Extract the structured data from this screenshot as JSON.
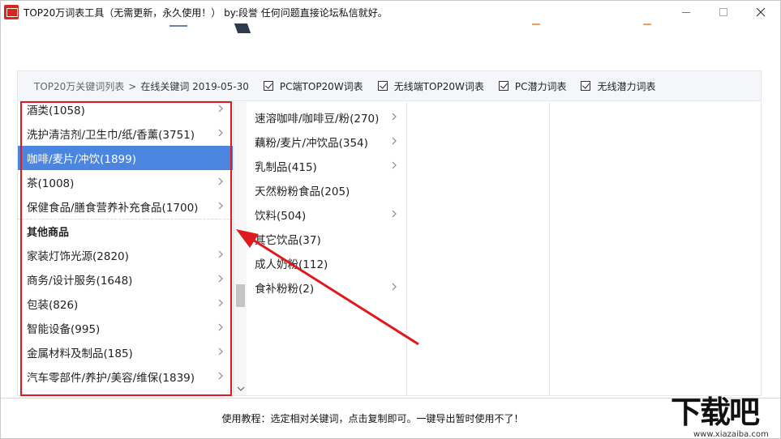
{
  "window": {
    "title": "TOP20万词表工具（无需更新，永久使用！） by:段誉  任何问题直接论坛私信就好。"
  },
  "toolbar": {
    "breadcrumb_root": "TOP20万关键词列表",
    "breadcrumb_sep": ">",
    "breadcrumb_current": "在线关键词 2019-05-30",
    "checkboxes": [
      {
        "label": "PC端TOP20W词表",
        "checked": true
      },
      {
        "label": "无线端TOP20W词表",
        "checked": true
      },
      {
        "label": "PC潜力词表",
        "checked": true
      },
      {
        "label": "无线潜力词表",
        "checked": true
      }
    ]
  },
  "category_list": {
    "items": [
      {
        "label": "酒类(1058)",
        "has_children": true
      },
      {
        "label": "洗护清洁剂/卫生巾/纸/香薰(3751)",
        "has_children": true
      },
      {
        "label": "咖啡/麦片/冲饮(1899)",
        "has_children": true,
        "selected": true
      },
      {
        "label": "茶(1008)",
        "has_children": true
      },
      {
        "label": "保健食品/膳食营养补充食品(1700)",
        "has_children": true
      },
      {
        "label": "其他商品",
        "group_title": true
      },
      {
        "label": "家装灯饰光源(2820)",
        "has_children": true
      },
      {
        "label": "商务/设计服务(1648)",
        "has_children": true
      },
      {
        "label": "包装(826)",
        "has_children": true
      },
      {
        "label": "智能设备(995)",
        "has_children": true
      },
      {
        "label": "金属材料及制品(185)",
        "has_children": true
      },
      {
        "label": "汽车零部件/养护/美容/维保(1839)",
        "has_children": true
      }
    ]
  },
  "subcategory_list": {
    "items": [
      {
        "label": "速溶咖啡/咖啡豆/粉(270)",
        "has_children": true
      },
      {
        "label": "藕粉/麦片/冲饮品(354)",
        "has_children": true
      },
      {
        "label": "乳制品(415)",
        "has_children": true
      },
      {
        "label": "天然粉粉食品(205)",
        "has_children": false
      },
      {
        "label": "饮料(504)",
        "has_children": true
      },
      {
        "label": "其它饮品(37)",
        "has_children": false
      },
      {
        "label": "成人奶粉(112)",
        "has_children": false
      },
      {
        "label": "食补粉粉(2)",
        "has_children": true
      }
    ]
  },
  "footer": {
    "text": "使用教程：选定相对关键词，点击复制即可。一键导出暂时使用不了！"
  },
  "watermark": {
    "main": "下载吧",
    "sub": "www.xiazaiba.com"
  },
  "colors": {
    "selected_bg": "#4a86e0",
    "annotation_red": "#e0191e",
    "toolbar_bg": "#f4f6f9"
  }
}
